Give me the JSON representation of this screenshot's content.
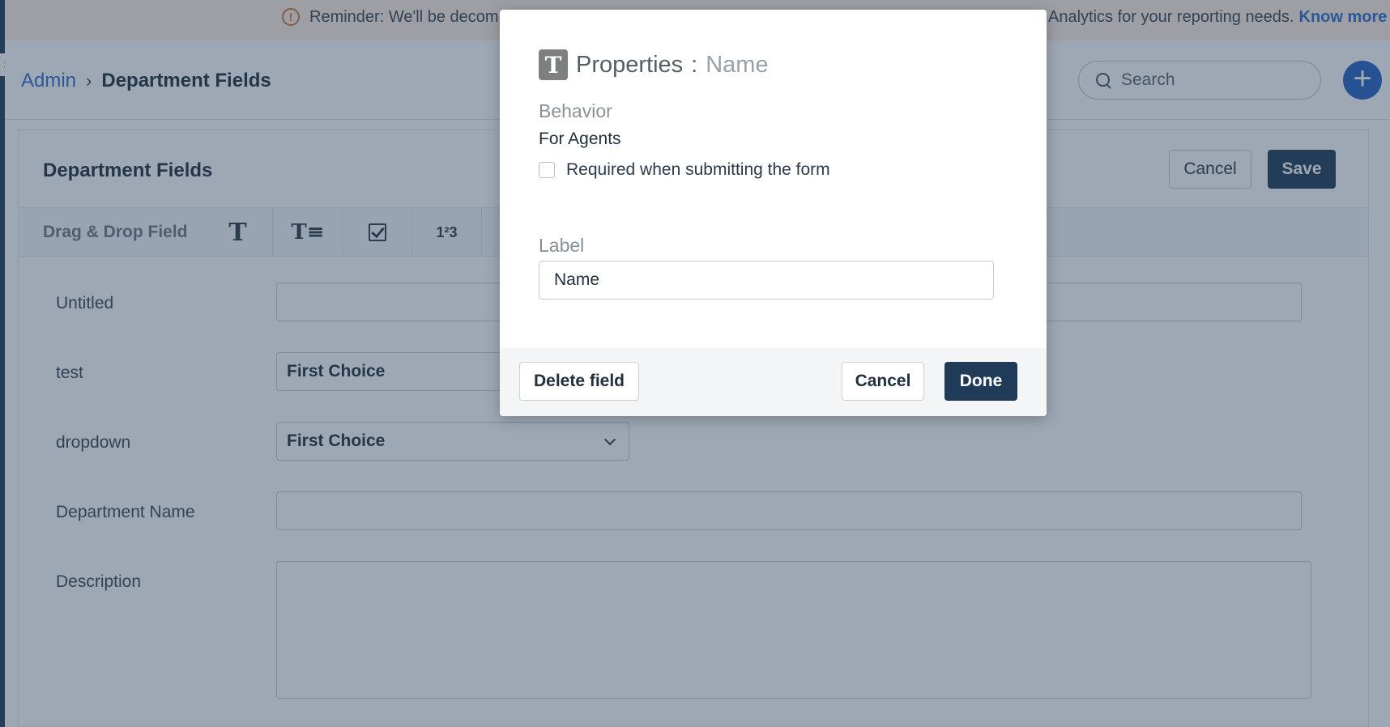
{
  "banner": {
    "text_left": "Reminder: We'll be decom",
    "text_right": "Analytics for your reporting needs.",
    "link": "Know more"
  },
  "breadcrumb": {
    "root": "Admin",
    "separator": "›",
    "current": "Department Fields"
  },
  "search": {
    "placeholder": "Search"
  },
  "add_button": "+",
  "card": {
    "title": "Department Fields",
    "cancel_label": "Cancel",
    "save_label": "Save"
  },
  "toolbar": {
    "label": "Drag & Drop Field",
    "tools": [
      {
        "name": "text-field-tool",
        "glyph": "T"
      },
      {
        "name": "paragraph-field-tool",
        "glyph": "T≡"
      },
      {
        "name": "checkbox-field-tool",
        "glyph": ""
      },
      {
        "name": "number-field-tool",
        "glyph": "1²3"
      }
    ]
  },
  "fields": [
    {
      "label": "Untitled",
      "value": ""
    },
    {
      "label": "test",
      "value": "First Choice"
    },
    {
      "label": "dropdown",
      "value": "First Choice"
    },
    {
      "label": "Department Name",
      "value": ""
    },
    {
      "label": "Description",
      "value": ""
    }
  ],
  "modal": {
    "icon": "T",
    "title": "Properties",
    "title_sep": ":",
    "title_name": "Name",
    "behavior_heading": "Behavior",
    "for_agents": "For Agents",
    "required_label": "Required when submitting the form",
    "required_checked": false,
    "label_heading": "Label",
    "label_value": "Name",
    "delete_label": "Delete field",
    "cancel_label": "Cancel",
    "done_label": "Done"
  },
  "colors": {
    "primary_dark": "#1f3b57",
    "link_blue": "#2f6ecb",
    "accent_blue": "#2563c4",
    "warning": "#d0763a"
  }
}
